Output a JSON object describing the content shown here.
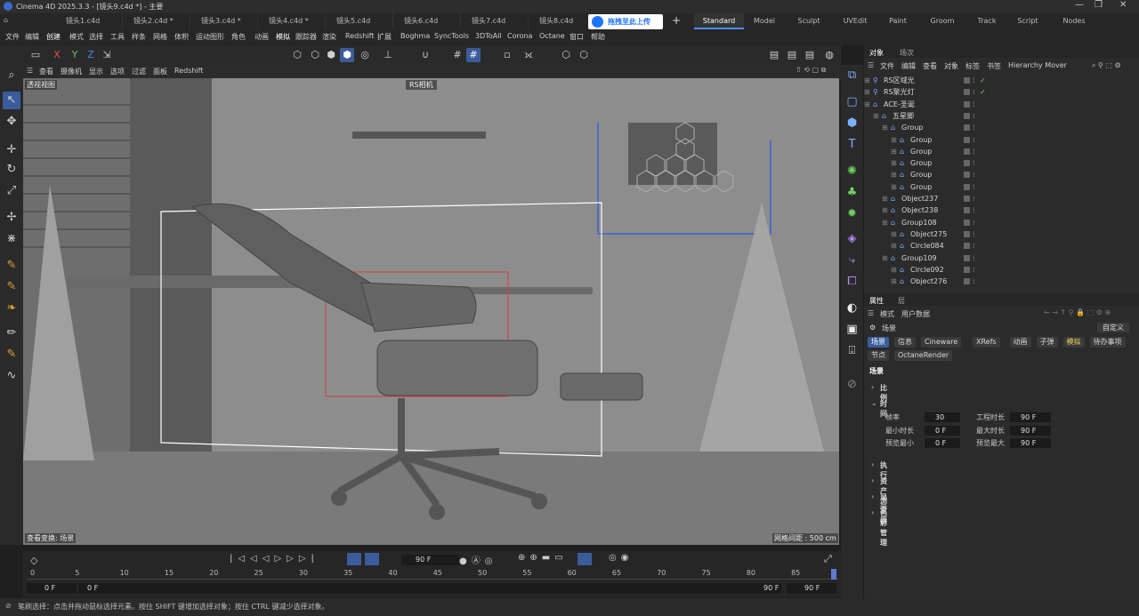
{
  "title": "Cinema 4D 2025.3.3 - [镜头9.c4d *] - 主要",
  "doc_tabs": [
    "镜头1.c4d",
    "镜头2.c4d *",
    "镜头3.c4d *",
    "镜头4.c4d *",
    "镜头5.c4d",
    "镜头6.c4d",
    "镜头7.c4d",
    "镜头8.c4d"
  ],
  "upload_badge": "拖拽至此上传",
  "layouts": [
    "Standard",
    "Model",
    "Sculpt",
    "UVEdit",
    "Paint",
    "Groom",
    "Track",
    "Script",
    "Nodes"
  ],
  "menu": [
    "文件",
    "编辑",
    "创建",
    "模式",
    "选择",
    "工具",
    "样条",
    "网格",
    "体积",
    "运动图形",
    "角色",
    "动画",
    "模拟",
    "跟踪器",
    "渲染",
    "Redshift",
    "扩展",
    "Boghma",
    "SyncTools",
    "3DToAll",
    "Corona",
    "Octane",
    "窗口",
    "帮助"
  ],
  "axes": [
    "X",
    "Y",
    "Z"
  ],
  "viewport_menu": [
    "查看",
    "摄像机",
    "显示",
    "选项",
    "过滤",
    "面板",
    "Redshift"
  ],
  "viewport": {
    "label": "透视视图",
    "camera": "RS相机",
    "bottom_left": "查看变换: 场景",
    "bottom_right": "网格间距 : 500 cm"
  },
  "timeline": {
    "frame_field": "90 F",
    "start_field": "0 F",
    "min_field": "0 F",
    "max_field": "90 F",
    "end_field": "90 F",
    "ticks": [
      "0",
      "5",
      "10",
      "15",
      "20",
      "25",
      "30",
      "35",
      "40",
      "45",
      "50",
      "55",
      "60",
      "65",
      "70",
      "75",
      "80",
      "85"
    ]
  },
  "status": "笔刷选择：点击并拖动鼠标选择元素。按住 SHIFT 键增加选择对象；按住 CTRL 键减少选择对象。",
  "obj_tabs": [
    "对象",
    "场次"
  ],
  "obj_menu": [
    "文件",
    "编辑",
    "查看",
    "对象",
    "标签",
    "书签",
    "Hierarchy Mover"
  ],
  "objects": [
    {
      "name": "RS区域光",
      "indent": 0,
      "check": true
    },
    {
      "name": "RS聚光灯",
      "indent": 0,
      "check": true
    },
    {
      "name": "ACE-圣诞",
      "indent": 0,
      "check": false
    },
    {
      "name": "五星脚",
      "indent": 1,
      "check": false
    },
    {
      "name": "Group",
      "indent": 2,
      "check": false
    },
    {
      "name": "Group",
      "indent": 3,
      "check": false
    },
    {
      "name": "Group",
      "indent": 3,
      "check": false
    },
    {
      "name": "Group",
      "indent": 3,
      "check": false
    },
    {
      "name": "Group",
      "indent": 3,
      "check": false
    },
    {
      "name": "Group",
      "indent": 3,
      "check": false
    },
    {
      "name": "Object237",
      "indent": 2,
      "check": false
    },
    {
      "name": "Object238",
      "indent": 2,
      "check": false
    },
    {
      "name": "Group108",
      "indent": 2,
      "check": false
    },
    {
      "name": "Object275",
      "indent": 3,
      "check": false
    },
    {
      "name": "Circle084",
      "indent": 3,
      "check": false
    },
    {
      "name": "Group109",
      "indent": 2,
      "check": false
    },
    {
      "name": "Circle092",
      "indent": 3,
      "check": false
    },
    {
      "name": "Object276",
      "indent": 3,
      "check": false
    }
  ],
  "attr_tabs": [
    "属性",
    "层"
  ],
  "attr_menu": [
    "模式",
    "用户数据"
  ],
  "attr_context": "场景",
  "attr_preset": "自定义",
  "attr_pills_row1": [
    "场景",
    "信息",
    "Cineware",
    "XRefs",
    "动画",
    "子弹",
    "模拟",
    "待办事项"
  ],
  "attr_pills_row2": [
    "节点",
    "OctaneRender"
  ],
  "attr_heading": "场景",
  "sections": [
    "比例",
    "时间",
    "执行",
    "资产浏览器",
    "显示",
    "色彩管理"
  ],
  "time_fields": {
    "fps_label": "帧率",
    "fps": "30",
    "proj_len_label": "工程时长",
    "proj_len": "90 F",
    "min_label": "最小时长",
    "min": "0 F",
    "max_label": "最大时长",
    "max": "90 F",
    "prev_min_label": "预览最小",
    "prev_min": "0 F",
    "prev_max_label": "预览最大",
    "prev_max": "90 F"
  }
}
